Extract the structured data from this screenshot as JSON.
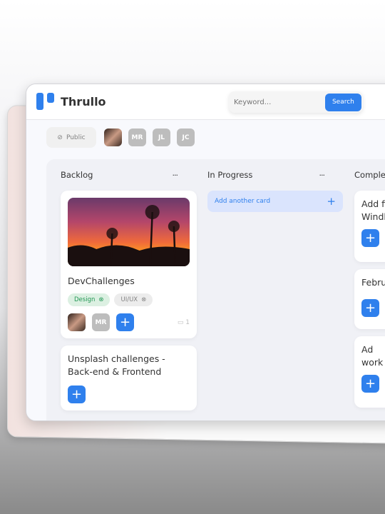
{
  "app": {
    "name": "Thrullo"
  },
  "search": {
    "placeholder": "Keyword...",
    "button": "Search"
  },
  "board": {
    "visibility": "Public",
    "members": [
      "MR",
      "JL",
      "JC"
    ]
  },
  "columns": [
    {
      "title": "Backlog",
      "menu": "···",
      "cards": [
        {
          "title": "DevChallenges",
          "tags": [
            "Design",
            "UI/UX"
          ],
          "members": [
            "MR"
          ],
          "comments": "1"
        },
        {
          "title": "Unsplash challenges - Back-end & Frontend"
        }
      ]
    },
    {
      "title": "In Progress",
      "menu": "···",
      "add_card": "Add another card"
    },
    {
      "title": "Comple",
      "cards": [
        {
          "title": "Add fi Windl"
        },
        {
          "title": "Febru"
        },
        {
          "title": "Ad work"
        }
      ]
    }
  ],
  "colors": {
    "accent": "#2f80ed",
    "tag_design": "#219653"
  }
}
